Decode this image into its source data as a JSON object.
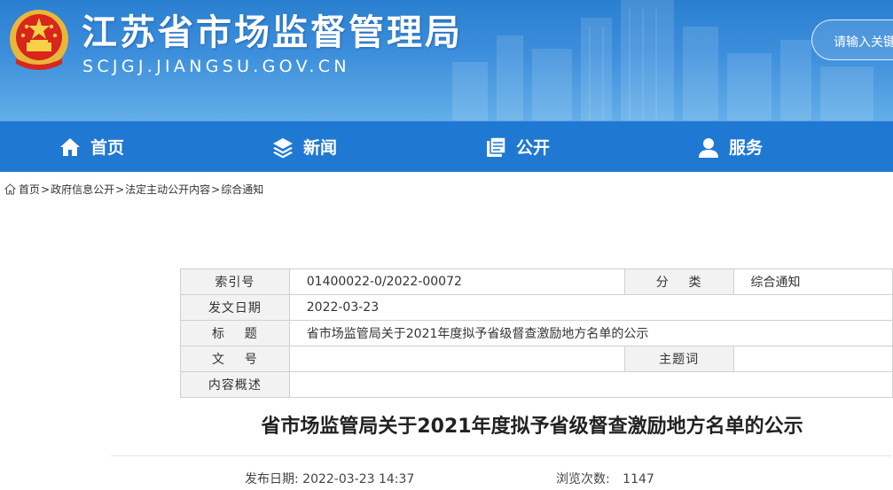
{
  "header": {
    "site_title": "江苏省市场监督管理局",
    "site_url": "SCJGJ.JIANGSU.GOV.CN",
    "search_placeholder": "请输入关键字"
  },
  "nav": {
    "items": [
      {
        "label": "首页",
        "icon": "home-icon"
      },
      {
        "label": "新闻",
        "icon": "layers-icon"
      },
      {
        "label": "公开",
        "icon": "document-stack-icon"
      },
      {
        "label": "服务",
        "icon": "user-service-icon"
      }
    ]
  },
  "breadcrumb": {
    "items": [
      "首页",
      "政府信息公开",
      "法定主动公开内容",
      "综合通知"
    ],
    "separator": ">"
  },
  "info": {
    "index_label": "索引号",
    "index_value": "01400022-0/2022-00072",
    "category_label": "分    类",
    "category_value": "综合通知",
    "date_label": "发文日期",
    "date_value": "2022-03-23",
    "title_label": "标    题",
    "title_value": "省市场监管局关于2021年度拟予省级督查激励地方名单的公示",
    "docno_label": "文    号",
    "docno_value": "",
    "keywords_label": "主题词",
    "keywords_value": "",
    "summary_label": "内容概述",
    "summary_value": ""
  },
  "article": {
    "title": "省市场监管局关于2021年度拟予省级督查激励地方名单的公示",
    "publish_label": "发布日期:",
    "publish_value": "2022-03-23 14:37",
    "views_label": "浏览次数:",
    "views_value": "1147"
  }
}
